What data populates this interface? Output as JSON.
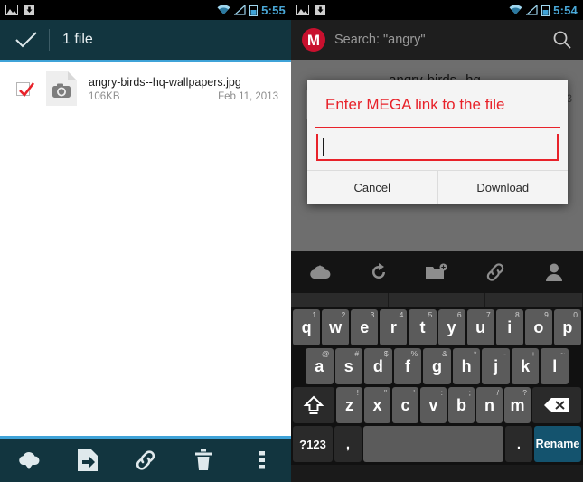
{
  "left": {
    "statusbar": {
      "time": "5:55",
      "icons": [
        "gallery-icon",
        "download-icon",
        "wifi-icon",
        "signal-icon",
        "battery-icon"
      ]
    },
    "actionbar": {
      "title": "1 file",
      "check_icon": "checkmark-icon"
    },
    "file": {
      "name": "angry-birds--hq-wallpapers.jpg",
      "size": "106KB",
      "date": "Feb 11, 2013",
      "selected": true,
      "thumb_icon": "camera-file-icon"
    },
    "bottombar": {
      "items": [
        {
          "name": "download-cloud-icon"
        },
        {
          "name": "move-file-icon"
        },
        {
          "name": "link-icon"
        },
        {
          "name": "trash-icon"
        },
        {
          "name": "overflow-menu-icon"
        }
      ]
    }
  },
  "right": {
    "statusbar": {
      "time": "5:54"
    },
    "search": {
      "logo": "M",
      "text": "Search: \"angry\"",
      "search_icon": "search-icon"
    },
    "background": {
      "filename": "angry-birds--hq-",
      "date_fragment": "13"
    },
    "dialog": {
      "title": "Enter MEGA link to the file",
      "input_value": "",
      "cancel_label": "Cancel",
      "download_label": "Download"
    },
    "toolbar": {
      "items": [
        {
          "name": "upload-cloud-icon"
        },
        {
          "name": "refresh-icon"
        },
        {
          "name": "new-folder-icon"
        },
        {
          "name": "link-icon"
        },
        {
          "name": "contacts-icon"
        }
      ]
    },
    "keyboard": {
      "row1": [
        {
          "key": "q",
          "sup": "1"
        },
        {
          "key": "w",
          "sup": "2"
        },
        {
          "key": "e",
          "sup": "3"
        },
        {
          "key": "r",
          "sup": "4"
        },
        {
          "key": "t",
          "sup": "5"
        },
        {
          "key": "y",
          "sup": "6"
        },
        {
          "key": "u",
          "sup": "7"
        },
        {
          "key": "i",
          "sup": "8"
        },
        {
          "key": "o",
          "sup": "9"
        },
        {
          "key": "p",
          "sup": "0"
        }
      ],
      "row2": [
        {
          "key": "a",
          "sup": "@"
        },
        {
          "key": "s",
          "sup": "#"
        },
        {
          "key": "d",
          "sup": "$"
        },
        {
          "key": "f",
          "sup": "%"
        },
        {
          "key": "g",
          "sup": "&"
        },
        {
          "key": "h",
          "sup": "*"
        },
        {
          "key": "j",
          "sup": "-"
        },
        {
          "key": "k",
          "sup": "+"
        },
        {
          "key": "l",
          "sup": "~"
        }
      ],
      "row3": [
        {
          "key": "z",
          "sup": "!"
        },
        {
          "key": "x",
          "sup": "\""
        },
        {
          "key": "c",
          "sup": "'"
        },
        {
          "key": "v",
          "sup": ":"
        },
        {
          "key": "b",
          "sup": ";"
        },
        {
          "key": "n",
          "sup": "/"
        },
        {
          "key": "m",
          "sup": "?"
        }
      ],
      "shift_icon": "shift-icon",
      "backspace_icon": "backspace-icon",
      "symbols_label": "?123",
      "comma": ",",
      "period": ".",
      "space": "",
      "action_label": "Rename"
    }
  }
}
